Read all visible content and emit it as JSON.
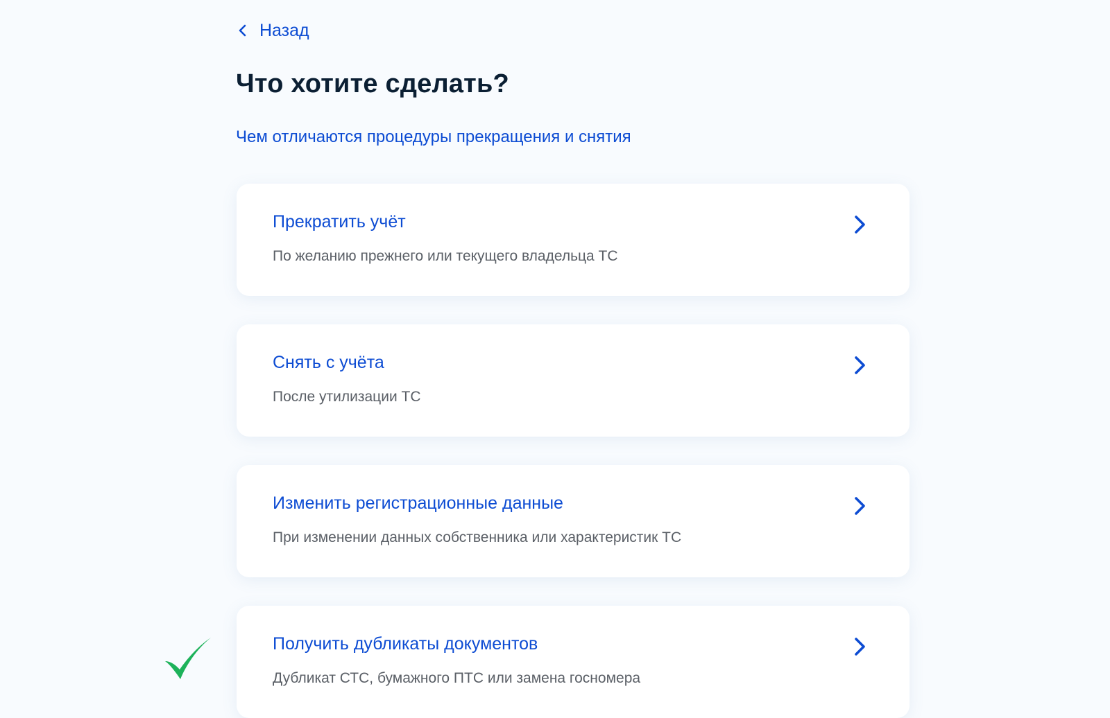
{
  "back": {
    "label": "Назад"
  },
  "page": {
    "title": "Что хотите сделать?",
    "info_link": "Чем отличаются процедуры прекращения и снятия"
  },
  "options": [
    {
      "title": "Прекратить учёт",
      "description": "По желанию прежнего или текущего владельца ТС"
    },
    {
      "title": "Снять с учёта",
      "description": "После утилизации ТС"
    },
    {
      "title": "Изменить регистрационные данные",
      "description": "При изменении данных собственника или характеристик ТС"
    },
    {
      "title": "Получить дубликаты документов",
      "description": "Дубликат СТС, бумажного ПТС или замена госномера"
    }
  ],
  "icons": {
    "back": "chevron-left-icon",
    "option_arrow": "chevron-right-icon",
    "marker": "checkmark-icon"
  },
  "colors": {
    "link": "#0d4cd3",
    "title": "#0b1f33",
    "description": "#5a5f66",
    "background": "#f8fbfe",
    "card": "#ffffff",
    "checkmark": "#1db25a"
  }
}
